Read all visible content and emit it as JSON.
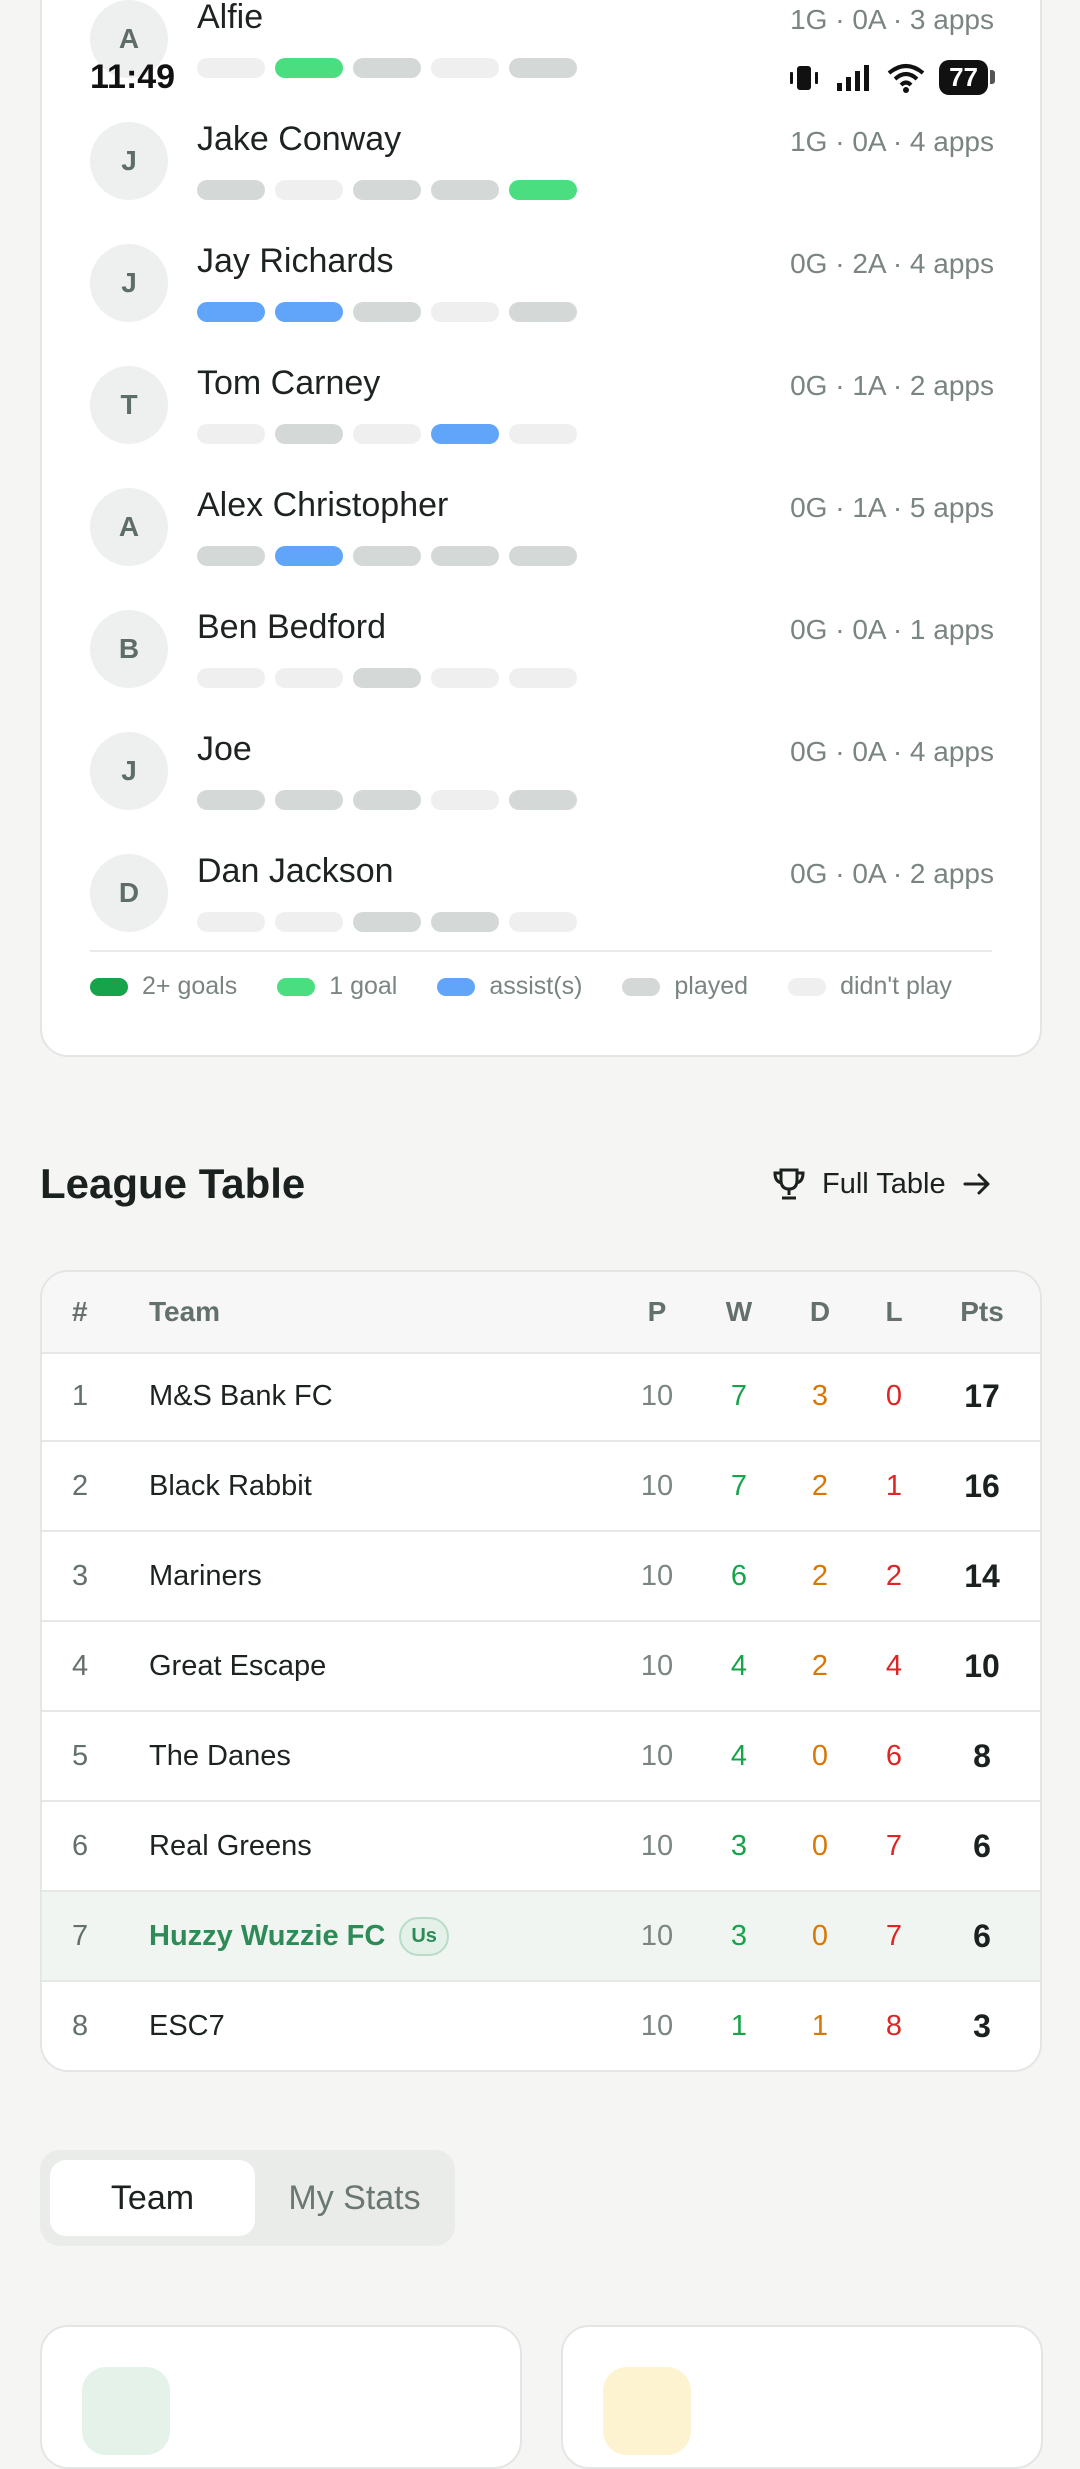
{
  "status": {
    "time": "11:49",
    "battery": "77"
  },
  "players": [
    {
      "initial": "A",
      "name": "Alfie",
      "stats": "1G · 0A · 3 apps",
      "pills": [
        "none",
        "one",
        "played",
        "none",
        "played"
      ]
    },
    {
      "initial": "J",
      "name": "Jake Conway",
      "stats": "1G · 0A · 4 apps",
      "pills": [
        "played",
        "none",
        "played",
        "played",
        "one"
      ]
    },
    {
      "initial": "J",
      "name": "Jay Richards",
      "stats": "0G · 2A · 4 apps",
      "pills": [
        "assist",
        "assist",
        "played",
        "none",
        "played"
      ]
    },
    {
      "initial": "T",
      "name": "Tom Carney",
      "stats": "0G · 1A · 2 apps",
      "pills": [
        "none",
        "played",
        "none",
        "assist",
        "none"
      ]
    },
    {
      "initial": "A",
      "name": "Alex Christopher",
      "stats": "0G · 1A · 5 apps",
      "pills": [
        "played",
        "assist",
        "played",
        "played",
        "played"
      ]
    },
    {
      "initial": "B",
      "name": "Ben Bedford",
      "stats": "0G · 0A · 1 apps",
      "pills": [
        "none",
        "none",
        "played",
        "none",
        "none"
      ]
    },
    {
      "initial": "J",
      "name": "Joe",
      "stats": "0G · 0A · 4 apps",
      "pills": [
        "played",
        "played",
        "played",
        "none",
        "played"
      ]
    },
    {
      "initial": "D",
      "name": "Dan Jackson",
      "stats": "0G · 0A · 2 apps",
      "pills": [
        "none",
        "none",
        "played",
        "played",
        "none"
      ]
    }
  ],
  "legend": {
    "two_goals": "2+ goals",
    "one_goal": "1 goal",
    "assists": "assist(s)",
    "played": "played",
    "didnt_play": "didn't play"
  },
  "league": {
    "title": "League Table",
    "full_table_label": "Full Table",
    "headers": {
      "pos": "#",
      "team": "Team",
      "p": "P",
      "w": "W",
      "d": "D",
      "l": "L",
      "pts": "Pts"
    },
    "us_badge": "Us",
    "rows": [
      {
        "pos": "1",
        "team": "M&S Bank FC",
        "p": "10",
        "w": "7",
        "d": "3",
        "l": "0",
        "pts": "17"
      },
      {
        "pos": "2",
        "team": "Black Rabbit",
        "p": "10",
        "w": "7",
        "d": "2",
        "l": "1",
        "pts": "16"
      },
      {
        "pos": "3",
        "team": "Mariners",
        "p": "10",
        "w": "6",
        "d": "2",
        "l": "2",
        "pts": "14"
      },
      {
        "pos": "4",
        "team": "Great Escape",
        "p": "10",
        "w": "4",
        "d": "2",
        "l": "4",
        "pts": "10"
      },
      {
        "pos": "5",
        "team": "The Danes",
        "p": "10",
        "w": "4",
        "d": "0",
        "l": "6",
        "pts": "8"
      },
      {
        "pos": "6",
        "team": "Real Greens",
        "p": "10",
        "w": "3",
        "d": "0",
        "l": "7",
        "pts": "6"
      },
      {
        "pos": "7",
        "team": "Huzzy Wuzzie FC",
        "p": "10",
        "w": "3",
        "d": "0",
        "l": "7",
        "pts": "6"
      },
      {
        "pos": "8",
        "team": "ESC7",
        "p": "10",
        "w": "1",
        "d": "1",
        "l": "8",
        "pts": "3"
      }
    ]
  },
  "segmented": {
    "team": "Team",
    "my_stats": "My Stats"
  },
  "colors": {
    "two_goals": "#16a34a",
    "one_goal": "#4ade80",
    "assist": "#60a5fa",
    "played": "#d4d8d6",
    "didnt_play": "#eeefee",
    "win": "#16a34a",
    "draw": "#d97706",
    "loss": "#dc2626",
    "our_team": "#2e8b57"
  }
}
